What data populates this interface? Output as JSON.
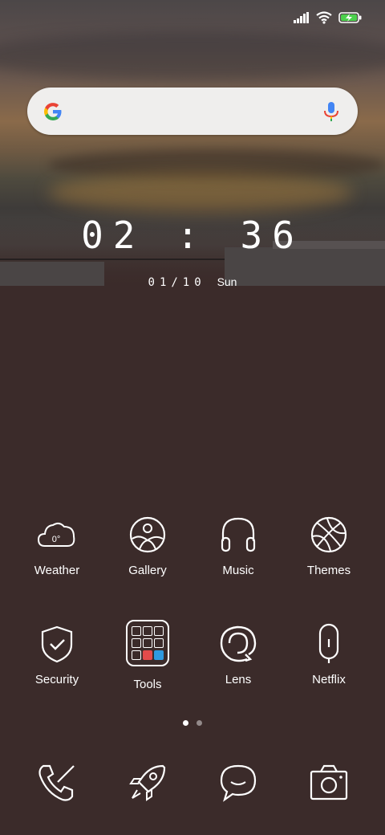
{
  "clock": {
    "time": "02 : 36",
    "date": "01/10",
    "weekday": "Sun"
  },
  "search": {
    "logo": "google-g-icon",
    "mic": "mic-icon"
  },
  "status": {
    "icons": [
      "signal-icon",
      "wifi-icon",
      "battery-charging-icon"
    ]
  },
  "apps_row1": [
    {
      "label": "Weather",
      "icon": "weather-cloud-icon",
      "temp": "0°"
    },
    {
      "label": "Gallery",
      "icon": "gallery-icon"
    },
    {
      "label": "Music",
      "icon": "headphones-icon"
    },
    {
      "label": "Themes",
      "icon": "basketball-icon"
    }
  ],
  "apps_row2": [
    {
      "label": "Security",
      "icon": "shield-check-icon"
    },
    {
      "label": "Tools",
      "icon": "folder-icon"
    },
    {
      "label": "Lens",
      "icon": "lens-icon"
    },
    {
      "label": "Netflix",
      "icon": "capsule-icon"
    }
  ],
  "page_indicator": {
    "pages": 2,
    "current": 1
  },
  "dock": [
    "phone-icon",
    "rocket-icon",
    "message-icon",
    "camera-icon"
  ]
}
